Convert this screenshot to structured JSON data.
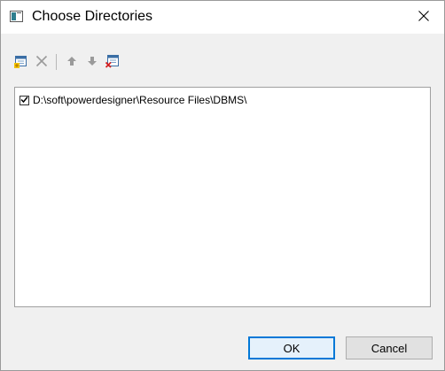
{
  "window": {
    "title": "Choose Directories"
  },
  "toolbar": {
    "buttons": [
      {
        "icon": "add-folder-icon",
        "enabled": true
      },
      {
        "icon": "delete-icon",
        "enabled": false
      },
      {
        "icon": "move-up-icon",
        "enabled": false
      },
      {
        "icon": "move-down-icon",
        "enabled": false
      },
      {
        "icon": "clear-list-icon",
        "enabled": true
      }
    ]
  },
  "directories": [
    {
      "path": "D:\\soft\\powerdesigner\\Resource Files\\DBMS\\",
      "checked": true
    }
  ],
  "buttons": {
    "ok_label": "OK",
    "cancel_label": "Cancel"
  },
  "colors": {
    "accent": "#0078d7",
    "dialog_bg": "#f0f0f0"
  }
}
